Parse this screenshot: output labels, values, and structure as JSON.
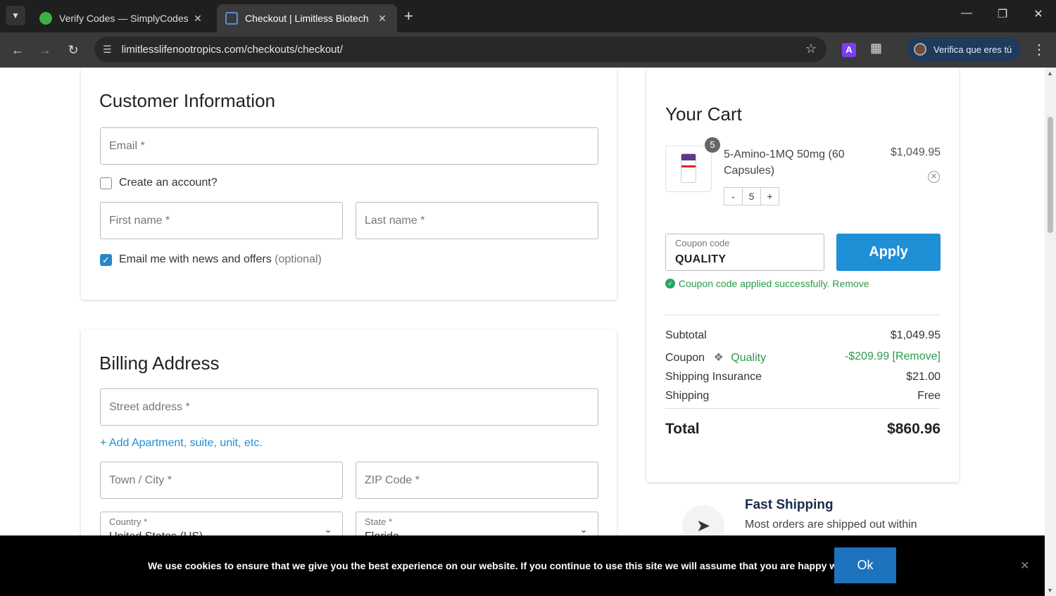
{
  "browser": {
    "tabs": [
      {
        "title": "Verify Codes — SimplyCodes",
        "favicon_color": "#3cb043"
      },
      {
        "title": "Checkout | Limitless Biotech",
        "favicon_color": "#5b8bd6"
      }
    ],
    "url": "limitlesslifenootropics.com/checkouts/checkout/",
    "profile_label": "Verifica que eres tú",
    "extension_letter": "A"
  },
  "customer_info": {
    "heading": "Customer Information",
    "email_placeholder": "Email *",
    "create_account_label": "Create an account?",
    "create_account_checked": false,
    "first_name_placeholder": "First name *",
    "last_name_placeholder": "Last name *",
    "news_label": "Email me with news and offers",
    "news_optional": "(optional)",
    "news_checked": true
  },
  "billing": {
    "heading": "Billing Address",
    "street_placeholder": "Street address *",
    "add_apartment": "+ Add Apartment, suite, unit, etc.",
    "city_placeholder": "Town / City *",
    "zip_placeholder": "ZIP Code *",
    "country_label": "Country *",
    "country_value": "United States (US)",
    "state_label": "State *",
    "state_value": "Florida"
  },
  "cart": {
    "heading": "Your Cart",
    "item": {
      "name": "5-Amino-1MQ 50mg (60 Capsules)",
      "price": "$1,049.95",
      "quantity": "5",
      "minus": "-",
      "plus": "+"
    },
    "coupon_label": "Coupon code",
    "coupon_value": "QUALITY",
    "apply_label": "Apply",
    "coupon_message": "Coupon code applied successfully. Remove",
    "subtotal_label": "Subtotal",
    "subtotal_value": "$1,049.95",
    "coupon_row_label": "Coupon",
    "coupon_row_name": "Quality",
    "coupon_row_value": "-$209.99 [Remove]",
    "insurance_label": "Shipping Insurance",
    "insurance_value": "$21.00",
    "shipping_label": "Shipping",
    "shipping_value": "Free",
    "total_label": "Total",
    "total_value": "$860.96"
  },
  "fast_shipping": {
    "title": "Fast Shipping",
    "desc": "Most orders are shipped out within"
  },
  "cookie_bar": {
    "message": "We use cookies to ensure that we give you the best experience on our website. If you continue to use this site we will assume that you are happy with it.",
    "ok_label": "Ok"
  },
  "colors": {
    "accent": "#1f8fd6",
    "success": "#2a9a4a",
    "cookie_button": "#1e73be"
  }
}
